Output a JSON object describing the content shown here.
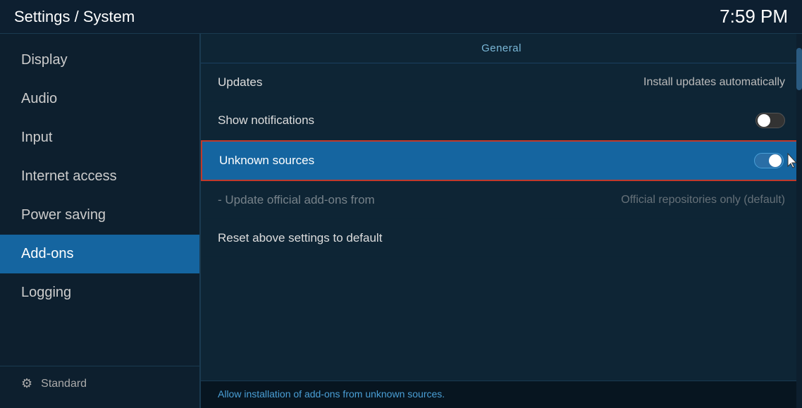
{
  "header": {
    "title": "Settings / System",
    "time": "7:59 PM"
  },
  "sidebar": {
    "items": [
      {
        "id": "display",
        "label": "Display",
        "active": false
      },
      {
        "id": "audio",
        "label": "Audio",
        "active": false
      },
      {
        "id": "input",
        "label": "Input",
        "active": false
      },
      {
        "id": "internet-access",
        "label": "Internet access",
        "active": false
      },
      {
        "id": "power-saving",
        "label": "Power saving",
        "active": false
      },
      {
        "id": "add-ons",
        "label": "Add-ons",
        "active": true
      },
      {
        "id": "logging",
        "label": "Logging",
        "active": false
      }
    ],
    "footer_icon": "⚙",
    "footer_label": "Standard"
  },
  "content": {
    "section_label": "General",
    "settings": [
      {
        "id": "updates",
        "label": "Updates",
        "value": "Install updates automatically",
        "type": "text",
        "highlighted": false,
        "dimmed": false
      },
      {
        "id": "show-notifications",
        "label": "Show notifications",
        "value": "",
        "type": "toggle",
        "toggle_state": "off",
        "highlighted": false,
        "dimmed": false
      },
      {
        "id": "unknown-sources",
        "label": "Unknown sources",
        "value": "",
        "type": "toggle",
        "toggle_state": "on",
        "highlighted": true,
        "dimmed": false
      },
      {
        "id": "update-addons",
        "label": "- Update official add-ons from",
        "value": "Official repositories only (default)",
        "type": "text",
        "highlighted": false,
        "dimmed": true
      },
      {
        "id": "reset-settings",
        "label": "Reset above settings to default",
        "value": "",
        "type": "none",
        "highlighted": false,
        "dimmed": false
      }
    ],
    "footer_text": "Allow installation of add-ons from unknown sources."
  }
}
